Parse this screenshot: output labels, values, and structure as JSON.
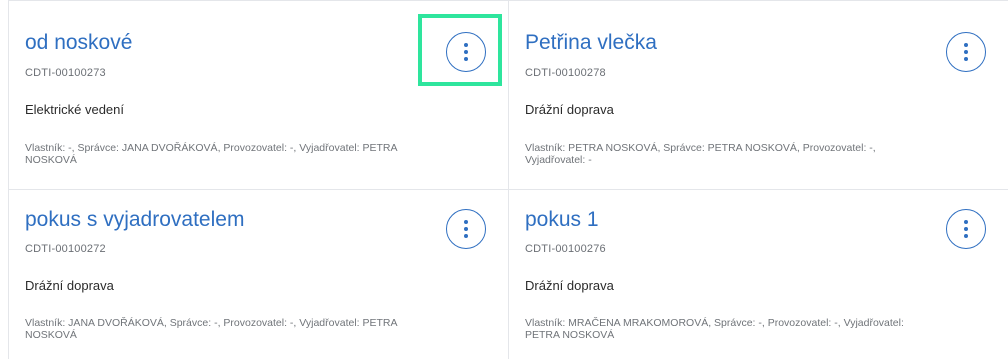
{
  "cards": [
    {
      "title": "od noskové",
      "code": "CDTI-00100273",
      "category": "Elektrické vedení",
      "roles": "Vlastník: -, Správce: JANA DVOŘÁKOVÁ, Provozovatel: -, Vyjadřovatel: PETRA NOSKOVÁ"
    },
    {
      "title": "Petřina vlečka",
      "code": "CDTI-00100278",
      "category": "Drážní doprava",
      "roles": "Vlastník: PETRA NOSKOVÁ, Správce: PETRA NOSKOVÁ, Provozovatel: -, Vyjadřovatel: -"
    },
    {
      "title": "pokus s vyjadrovatelem",
      "code": "CDTI-00100272",
      "category": "Drážní doprava",
      "roles": "Vlastník: JANA DVOŘÁKOVÁ, Správce: -, Provozovatel: -, Vyjadřovatel: PETRA NOSKOVÁ"
    },
    {
      "title": "pokus 1",
      "code": "CDTI-00100276",
      "category": "Drážní doprava",
      "roles": "Vlastník: MRAČENA MRAKOMOROVÁ, Správce: -, Provozovatel: -, Vyjadřovatel: PETRA NOSKOVÁ"
    }
  ],
  "colors": {
    "accent": "#2f6fc1",
    "highlight": "#2ee59d"
  },
  "icons": {
    "menu": "more-vertical-icon"
  }
}
